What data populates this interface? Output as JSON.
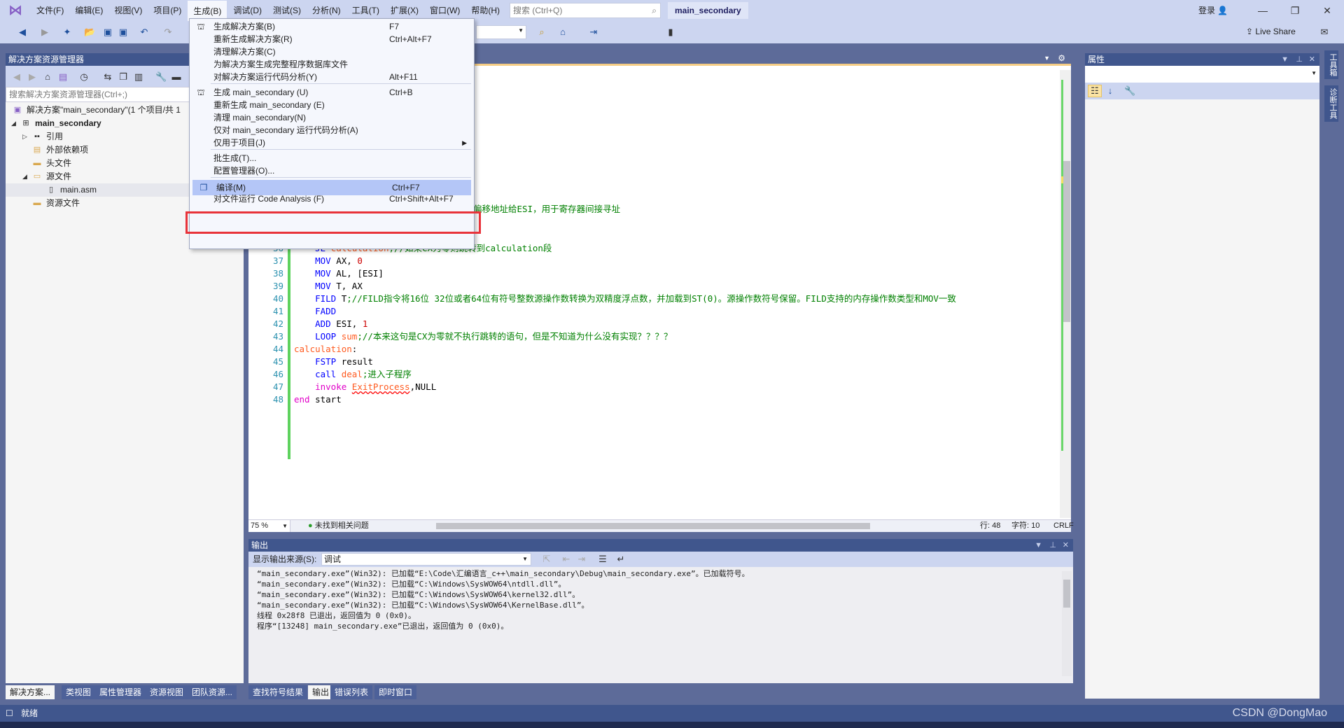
{
  "titlebar": {
    "menus": [
      "文件(F)",
      "编辑(E)",
      "视图(V)",
      "项目(P)",
      "生成(B)",
      "调试(D)",
      "测试(S)",
      "分析(N)",
      "工具(T)",
      "扩展(X)",
      "窗口(W)",
      "帮助(H)"
    ],
    "search_placeholder": "搜索 (Ctrl+Q)",
    "project_title": "main_secondary",
    "login": "登录",
    "live_share": "Live Share"
  },
  "build_menu": {
    "items": [
      {
        "label": "生成解决方案(B)",
        "shortcut": "F7"
      },
      {
        "label": "重新生成解决方案(R)",
        "shortcut": "Ctrl+Alt+F7"
      },
      {
        "label": "清理解决方案(C)",
        "shortcut": ""
      },
      {
        "label": "为解决方案生成完整程序数据库文件",
        "shortcut": ""
      },
      {
        "label": "对解决方案运行代码分析(Y)",
        "shortcut": "Alt+F11"
      },
      {
        "label": "生成 main_secondary (U)",
        "shortcut": "Ctrl+B"
      },
      {
        "label": "重新生成 main_secondary (E)",
        "shortcut": ""
      },
      {
        "label": "清理 main_secondary(N)",
        "shortcut": ""
      },
      {
        "label": "仅对 main_secondary 运行代码分析(A)",
        "shortcut": ""
      },
      {
        "label": "仅用于项目(J)",
        "shortcut": ""
      },
      {
        "label": "批生成(T)...",
        "shortcut": ""
      },
      {
        "label": "配置管理器(O)...",
        "shortcut": ""
      },
      {
        "label": "编译(M)",
        "shortcut": "Ctrl+F7"
      },
      {
        "label": "对文件运行 Code Analysis (F)",
        "shortcut": "Ctrl+Shift+Alt+F7"
      }
    ],
    "highlighted": "编译(M)",
    "annotation_color": "#e8333a"
  },
  "solution_explorer": {
    "title": "解决方案资源管理器",
    "search_placeholder": "搜索解决方案资源管理器(Ctrl+;)",
    "tree": [
      "解决方案\"main_secondary\"(1 个项目/共 1",
      "main_secondary",
      "引用",
      "外部依赖项",
      "头文件",
      "源文件",
      "main.asm",
      "资源文件"
    ]
  },
  "editor": {
    "partial_comment": "偏移地址给ESI，用于寄存器间接寻址",
    "lines": [
      {
        "n": "36",
        "parts": [
          [
            "kw",
            "    JE "
          ],
          [
            "lbl",
            "calculation"
          ],
          [
            "cm",
            ";//如果CX为零则跳转到calculation段"
          ]
        ]
      },
      {
        "n": "37",
        "parts": [
          [
            "kw",
            "    MOV "
          ],
          [
            "plain",
            "AX, "
          ],
          [
            "num",
            "0"
          ]
        ]
      },
      {
        "n": "38",
        "parts": [
          [
            "kw",
            "    MOV "
          ],
          [
            "plain",
            "AL, [ESI]"
          ]
        ]
      },
      {
        "n": "39",
        "parts": [
          [
            "kw",
            "    MOV "
          ],
          [
            "plain",
            "T, AX"
          ]
        ]
      },
      {
        "n": "40",
        "parts": [
          [
            "kw",
            "    FILD "
          ],
          [
            "plain",
            "T"
          ],
          [
            "cm",
            ";//FILD指令将16位 32位或者64位有符号整数源操作数转换为双精度浮点数，并加载到ST(0)。源操作数符号保留。FILD支持的内存操作数类型和MOV一致"
          ]
        ]
      },
      {
        "n": "41",
        "parts": [
          [
            "kw",
            "    FADD"
          ]
        ]
      },
      {
        "n": "42",
        "parts": [
          [
            "kw",
            "    ADD "
          ],
          [
            "plain",
            "ESI, "
          ],
          [
            "num",
            "1"
          ]
        ]
      },
      {
        "n": "43",
        "parts": [
          [
            "kw",
            "    LOOP "
          ],
          [
            "lbl",
            "sum"
          ],
          [
            "cm",
            ";//本来这句是CX为零就不执行跳转的语句，但是不知道为什么没有实现？？？？"
          ]
        ]
      },
      {
        "n": "44",
        "parts": [
          [
            "lbl",
            "calculation"
          ],
          [
            "plain",
            ":"
          ]
        ]
      },
      {
        "n": "45",
        "parts": [
          [
            "kw",
            "    FSTP "
          ],
          [
            "plain",
            "result"
          ]
        ]
      },
      {
        "n": "46",
        "parts": [
          [
            "kw",
            "    call "
          ],
          [
            "lbl",
            "deal"
          ],
          [
            "cm",
            ";进入子程序"
          ]
        ]
      },
      {
        "n": "47",
        "parts": [
          [
            "inv",
            "    invoke "
          ],
          [
            "lbl",
            "ExitProcess"
          ],
          [
            "plain",
            ",NULL"
          ]
        ]
      },
      {
        "n": "48",
        "parts": [
          [
            "inv",
            "end "
          ],
          [
            "plain",
            "start"
          ]
        ]
      }
    ],
    "status": {
      "zoom": "75 %",
      "issues": "未找到相关问题",
      "line": "行: 48",
      "char": "字符: 10",
      "eol": "CRLF"
    }
  },
  "output": {
    "title": "输出",
    "source_label": "显示输出来源(S):",
    "source_value": "调试",
    "lines": [
      "“main_secondary.exe”(Win32): 已加载“E:\\Code\\汇编语言_c++\\main_secondary\\Debug\\main_secondary.exe”。已加载符号。",
      "“main_secondary.exe”(Win32): 已加载“C:\\Windows\\SysWOW64\\ntdll.dll”。",
      "“main_secondary.exe”(Win32): 已加载“C:\\Windows\\SysWOW64\\kernel32.dll”。",
      "“main_secondary.exe”(Win32): 已加载“C:\\Windows\\SysWOW64\\KernelBase.dll”。",
      "线程 0x28f8 已退出，返回值为 0 (0x0)。",
      "程序“[13248] main_secondary.exe”已退出，返回值为 0 (0x0)。"
    ]
  },
  "properties": {
    "title": "属性"
  },
  "bottom_tabs_left": [
    "解决方案...",
    "类视图",
    "属性管理器",
    "资源视图",
    "团队资源..."
  ],
  "bottom_tabs_right": [
    "查找符号结果",
    "输出",
    "错误列表",
    "即时窗口"
  ],
  "right_strip": [
    "工具箱",
    "诊断工具"
  ],
  "status": {
    "text": "就绪",
    "watermark": "CSDN @DongMao"
  }
}
